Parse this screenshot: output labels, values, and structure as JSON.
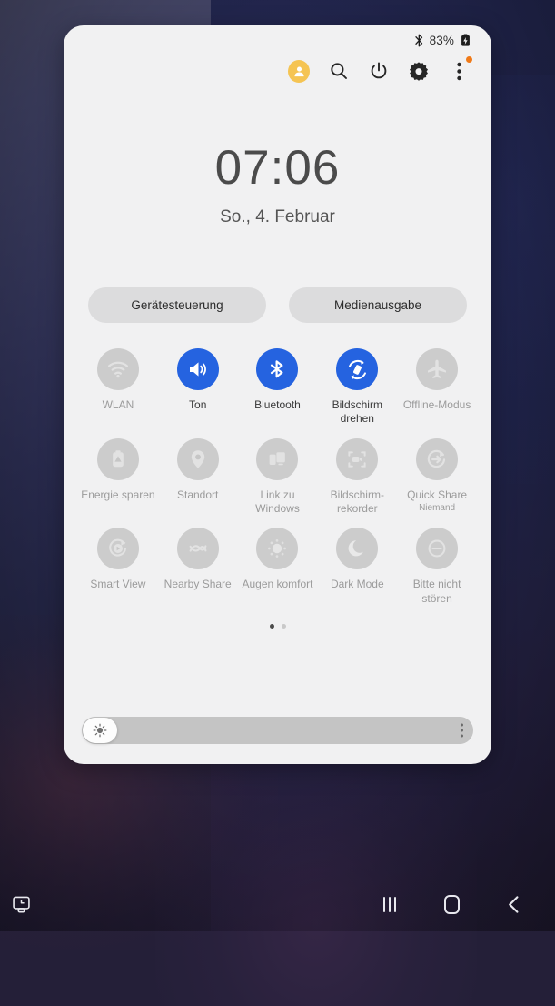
{
  "status_bar": {
    "bluetooth_icon": "bluetooth-icon",
    "battery_percent": "83%",
    "battery_icon": "battery-charging-icon"
  },
  "header": {
    "icons": [
      {
        "name": "profile-avatar",
        "label": "Profil"
      },
      {
        "name": "search-icon",
        "label": "Suchen"
      },
      {
        "name": "power-icon",
        "label": "Ein/Aus"
      },
      {
        "name": "settings-gear-icon",
        "label": "Einstellungen"
      },
      {
        "name": "more-options-icon",
        "label": "Mehr"
      }
    ],
    "avatar_color": "#f5c453",
    "badge_color": "#f07a18"
  },
  "clock": {
    "time": "07:06",
    "date": "So., 4. Februar"
  },
  "pills": [
    {
      "label": "Gerätesteuerung",
      "name": "device-control-button"
    },
    {
      "label": "Medienausgabe",
      "name": "media-output-button"
    }
  ],
  "toggles": [
    {
      "label": "WLAN",
      "state": "off",
      "icon": "wifi-icon",
      "name": "toggle-wlan"
    },
    {
      "label": "Ton",
      "state": "on",
      "icon": "sound-icon",
      "name": "toggle-ton"
    },
    {
      "label": "Bluetooth",
      "state": "on",
      "icon": "bluetooth-icon",
      "name": "toggle-bluetooth"
    },
    {
      "label": "Bildschirm drehen",
      "state": "on",
      "icon": "screen-rotate-icon",
      "name": "toggle-screen-rotation"
    },
    {
      "label": "Offline-Modus",
      "state": "off",
      "icon": "airplane-icon",
      "name": "toggle-airplane-mode"
    },
    {
      "label": "Energie sparen",
      "state": "off",
      "icon": "battery-saver-icon",
      "name": "toggle-power-saving"
    },
    {
      "label": "Standort",
      "state": "off",
      "icon": "location-pin-icon",
      "name": "toggle-location"
    },
    {
      "label": "Link zu Windows",
      "state": "off",
      "icon": "link-to-windows-icon",
      "name": "toggle-link-to-windows"
    },
    {
      "label": "Bildschirm- rekorder",
      "state": "off",
      "icon": "screen-recorder-icon",
      "name": "toggle-screen-recorder"
    },
    {
      "label": "Quick Share",
      "state": "off",
      "icon": "quick-share-icon",
      "name": "toggle-quick-share",
      "sub": "Niemand"
    },
    {
      "label": "Smart View",
      "state": "off",
      "icon": "smart-view-icon",
      "name": "toggle-smart-view"
    },
    {
      "label": "Nearby Share",
      "state": "off",
      "icon": "nearby-share-icon",
      "name": "toggle-nearby-share"
    },
    {
      "label": "Augen komfort",
      "state": "off",
      "icon": "eye-comfort-sun-icon",
      "name": "toggle-eye-comfort"
    },
    {
      "label": "Dark Mode",
      "state": "off",
      "icon": "moon-icon",
      "name": "toggle-dark-mode"
    },
    {
      "label": "Bitte nicht stören",
      "state": "off",
      "icon": "do-not-disturb-icon",
      "name": "toggle-do-not-disturb"
    }
  ],
  "page_indicator": {
    "total": 2,
    "active": 1
  },
  "brightness": {
    "value_percent": 2,
    "thumb_icon": "brightness-sun-icon",
    "menu_icon": "brightness-options-icon"
  },
  "nav_bar": {
    "screenshot_icon": "screenshot-capture-icon",
    "recents_icon": "recents-icon",
    "home_icon": "home-icon",
    "back_icon": "back-icon"
  },
  "colors": {
    "toggle_on": "#2563e0",
    "toggle_off": "#cccccc",
    "panel_bg": "#f1f1f2",
    "pill_bg": "#dcdcdd"
  }
}
